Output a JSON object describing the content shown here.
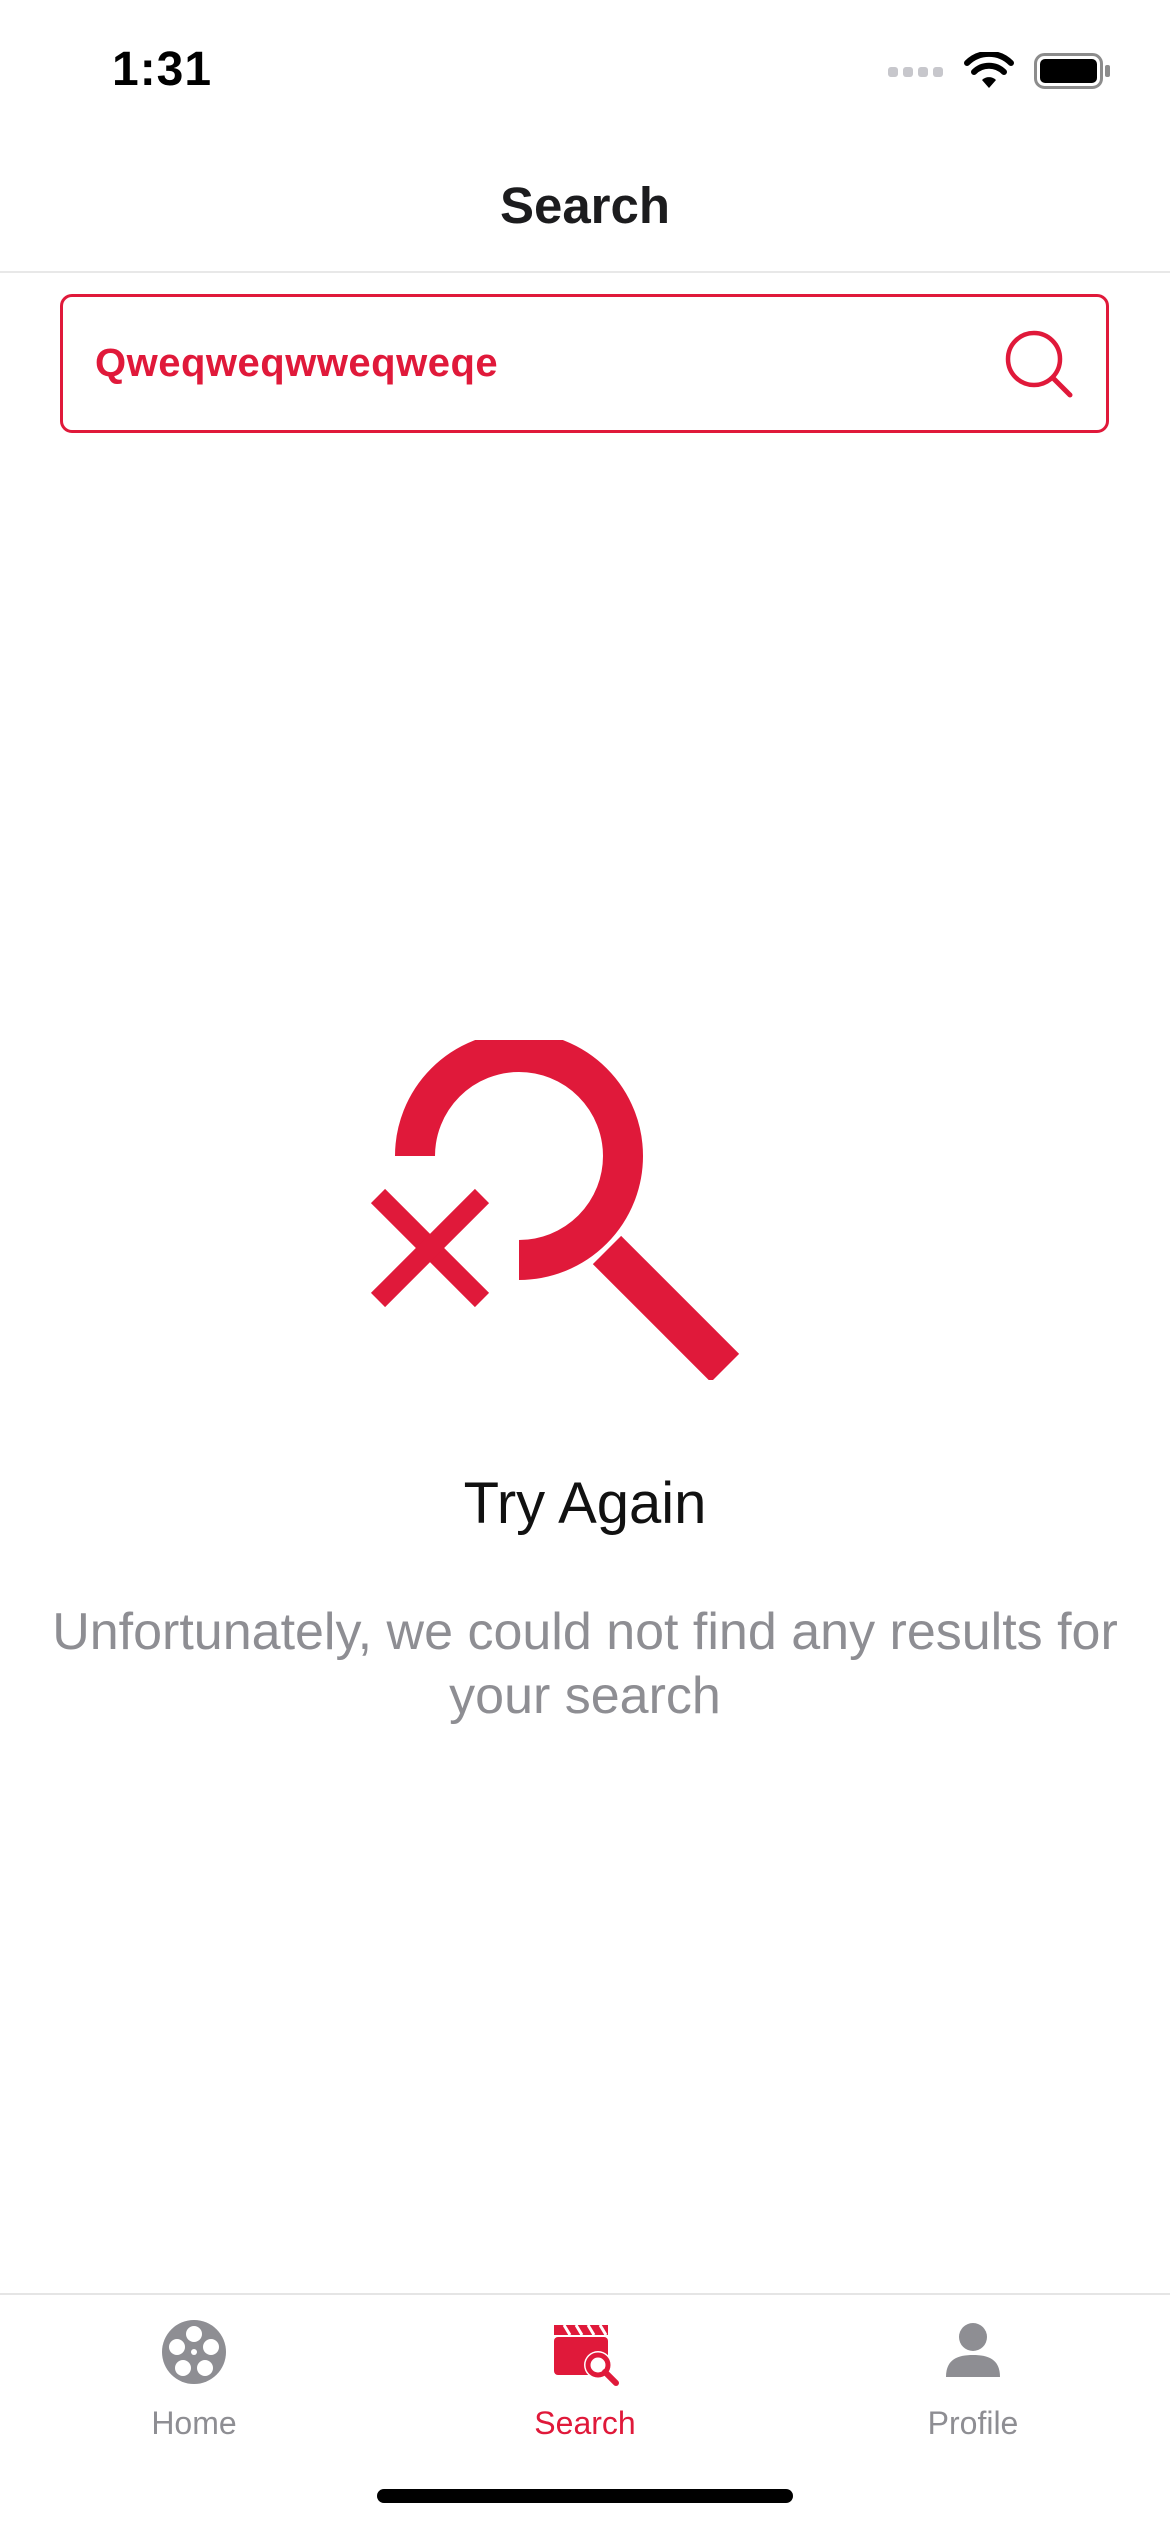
{
  "status_bar": {
    "time": "1:31"
  },
  "nav": {
    "title": "Search"
  },
  "search": {
    "value": "Qweqweqwweqweqe"
  },
  "empty_state": {
    "title": "Try Again",
    "message": "Unfortunately, we could not find any results for your search"
  },
  "tab_bar": {
    "tabs": [
      {
        "label": "Home",
        "icon": "film-reel-icon",
        "active": false
      },
      {
        "label": "Search",
        "icon": "clapperboard-search-icon",
        "active": true
      },
      {
        "label": "Profile",
        "icon": "person-icon",
        "active": false
      }
    ]
  },
  "colors": {
    "accent": "#e0193a",
    "inactive": "#8e8e93",
    "title": "#1c1c1e"
  }
}
